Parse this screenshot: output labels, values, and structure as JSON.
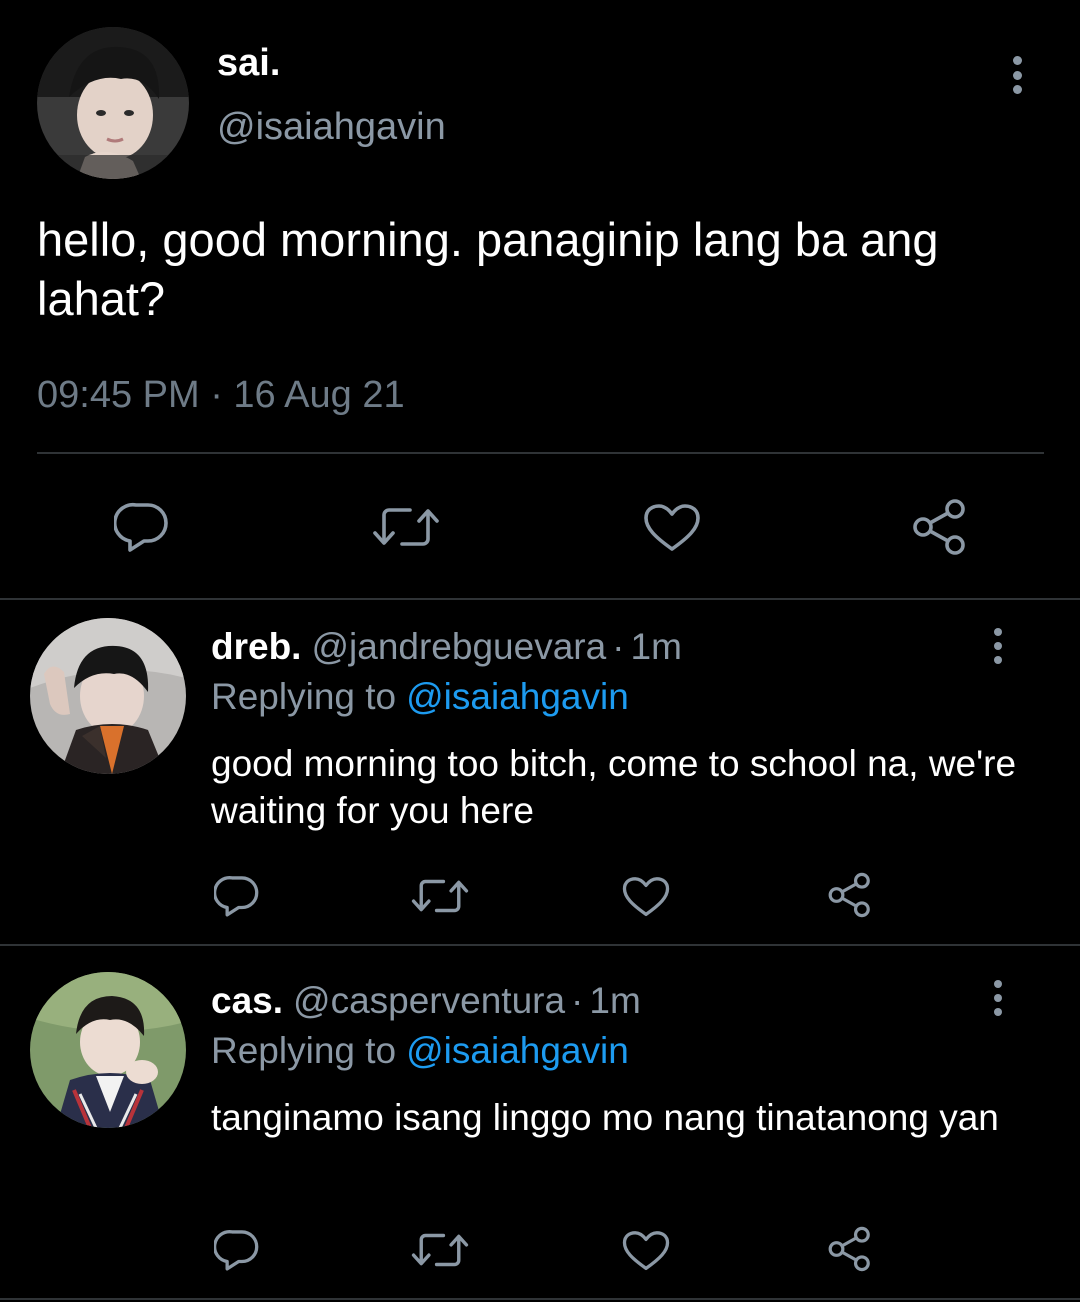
{
  "main_tweet": {
    "display_name": "sai.",
    "handle": "@isaiahgavin",
    "text": "hello, good morning. panaginip lang ba ang lahat?",
    "timestamp": "09:45 PM · 16 Aug 21",
    "actions": [
      "reply-icon",
      "retweet-icon",
      "like-icon",
      "share-icon"
    ]
  },
  "replies": [
    {
      "display_name": "dreb.",
      "handle": "@jandrebguevara",
      "separator": "·",
      "time": "1m",
      "replying_prefix": "Replying to",
      "replying_to": "@isaiahgavin",
      "text": "good morning too bitch, come to school na, we're waiting for you here"
    },
    {
      "display_name": "cas.",
      "handle": "@casperventura",
      "separator": "·",
      "time": "1m",
      "replying_prefix": "Replying to",
      "replying_to": "@isaiahgavin",
      "text": "tanginamo isang linggo mo nang tinatanong yan"
    }
  ],
  "colors": {
    "background": "#000000",
    "text_primary": "#ffffff",
    "text_secondary": "#8b98a5",
    "link": "#1d9bf0",
    "divider": "#2f3336"
  }
}
